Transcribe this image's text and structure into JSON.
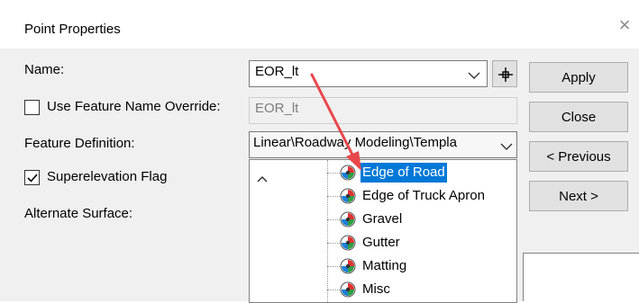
{
  "window": {
    "title": "Point Properties",
    "close_glyph": "×"
  },
  "form": {
    "name_label": "Name:",
    "name_value": "EOR_lt",
    "override_label": "Use Feature Name Override:",
    "override_checked": false,
    "override_value": "EOR_lt",
    "feature_def_label": "Feature Definition:",
    "feature_def_value": "Linear\\Roadway Modeling\\Templa",
    "superelevation_label": "Superelevation Flag",
    "superelevation_checked": true,
    "alternate_surface_label": "Alternate Surface:"
  },
  "buttons": {
    "apply": "Apply",
    "close": "Close",
    "previous": "< Previous",
    "next": "Next >"
  },
  "tree": {
    "scroll_up_glyph": "^",
    "items": [
      {
        "label": "Edge of Road",
        "selected": true
      },
      {
        "label": "Edge of Truck Apron",
        "selected": false
      },
      {
        "label": "Gravel",
        "selected": false
      },
      {
        "label": "Gutter",
        "selected": false
      },
      {
        "label": "Matting",
        "selected": false
      },
      {
        "label": "Misc",
        "selected": false
      }
    ]
  },
  "icons": {
    "pick": "crosshair-pick-icon",
    "feature": "feature-definition-icon",
    "annotation": "red-arrow-annotation"
  },
  "colors": {
    "selection": "#0078d7",
    "arrow": "#e8474c",
    "dialog_bg": "#f0f0f0"
  }
}
